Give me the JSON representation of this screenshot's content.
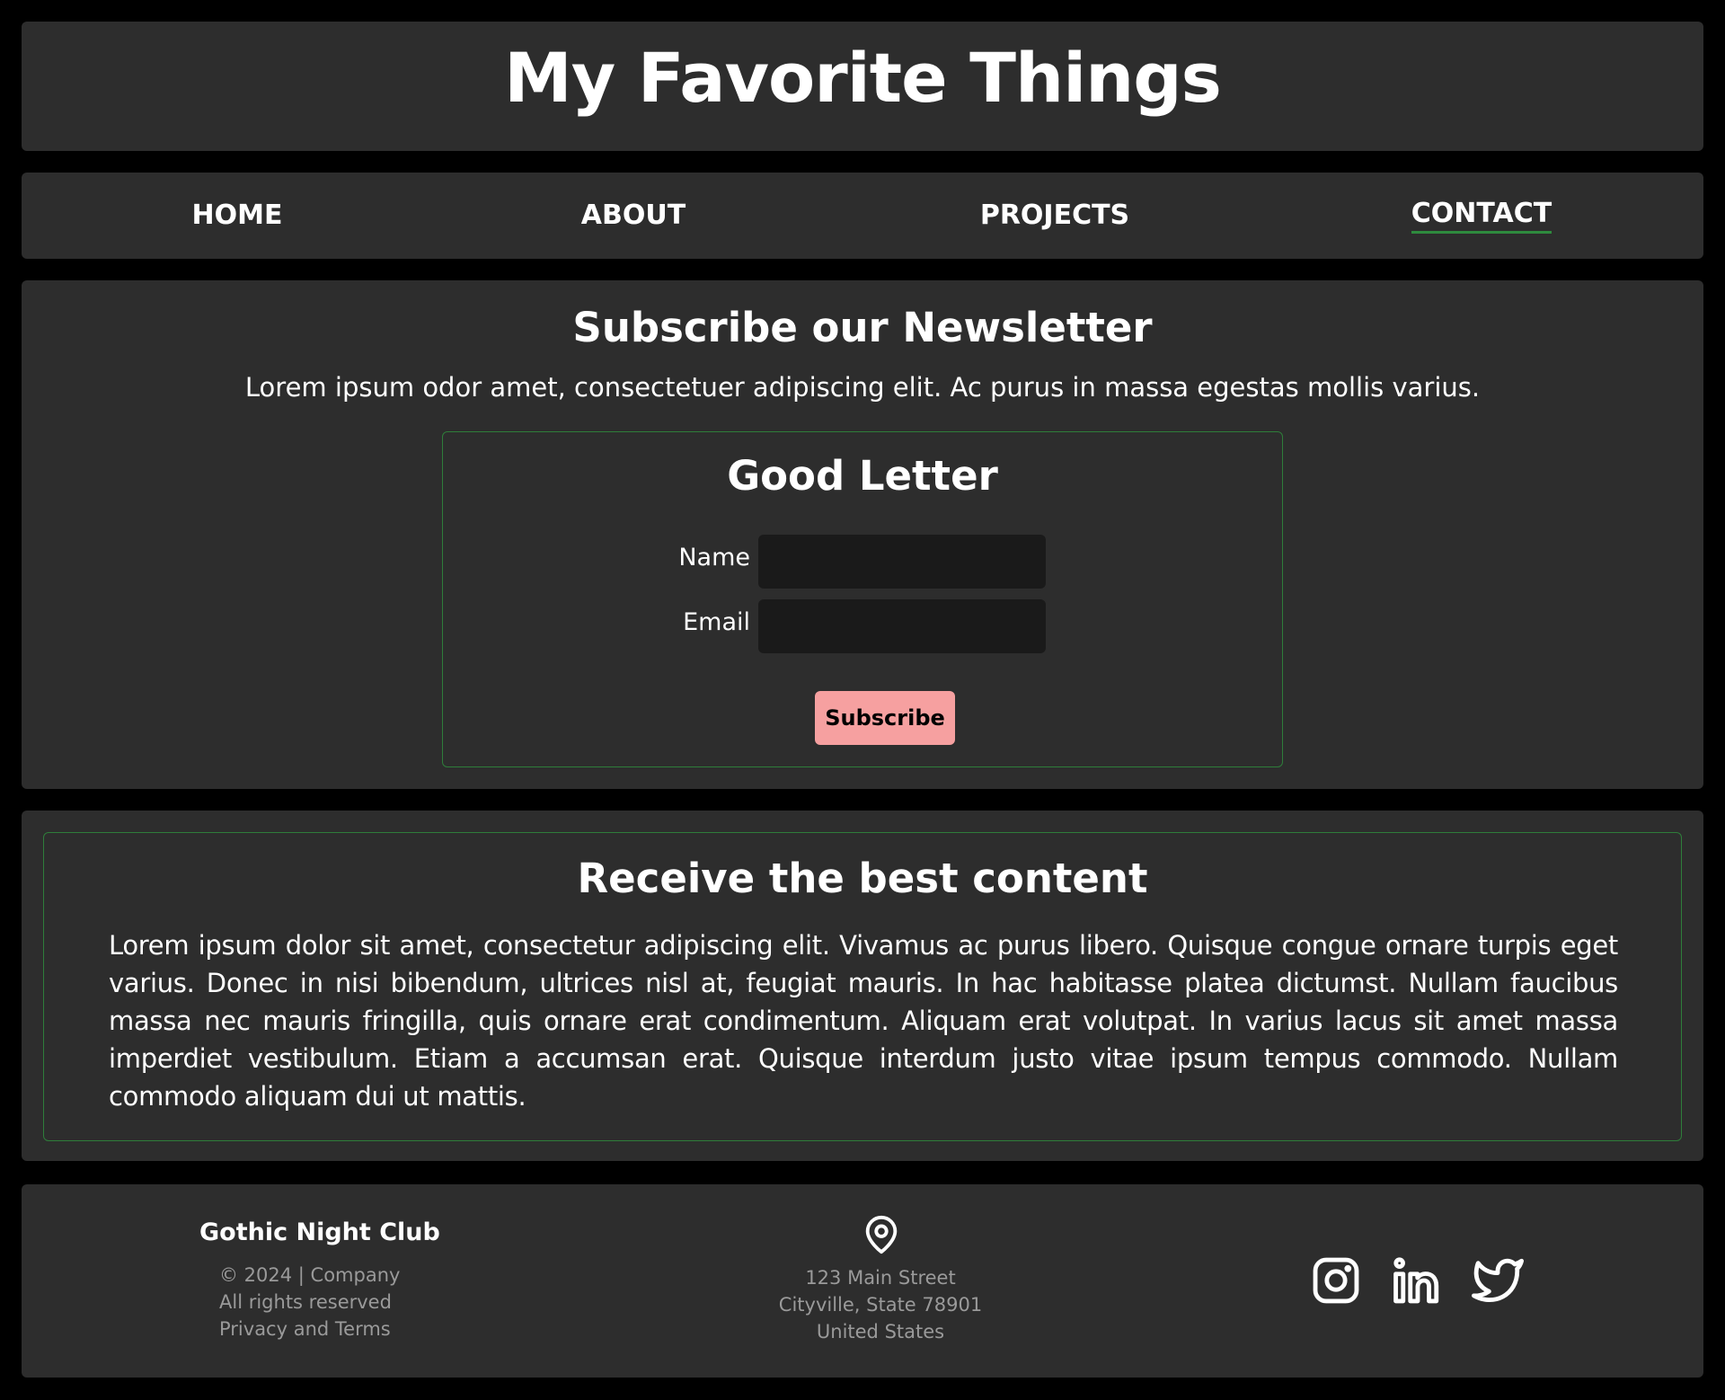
{
  "header": {
    "title": "My Favorite Things"
  },
  "nav": {
    "items": [
      {
        "label": "HOME"
      },
      {
        "label": "ABOUT"
      },
      {
        "label": "PROJECTS"
      },
      {
        "label": "CONTACT",
        "active": true
      }
    ],
    "active_underline_color": "#2e8b3e"
  },
  "newsletter": {
    "heading": "Subscribe our Newsletter",
    "lead": "Lorem ipsum odor amet, consectetuer adipiscing elit. Ac purus in massa egestas mollis varius.",
    "form": {
      "title": "Good Letter",
      "name_label": "Name",
      "name_value": "",
      "email_label": "Email",
      "email_value": "",
      "submit_label": "Subscribe"
    }
  },
  "content": {
    "heading": "Receive the best content",
    "body": "Lorem ipsum dolor sit amet, consectetur adipiscing elit. Vivamus ac purus libero. Quisque congue ornare turpis eget varius. Donec in nisi bibendum, ultrices nisl at, feugiat mauris. In hac habitasse platea dictumst. Nullam faucibus massa nec mauris fringilla, quis ornare erat condimentum. Aliquam erat volutpat. In varius lacus sit amet massa imperdiet vestibulum. Etiam a accumsan erat. Quisque interdum justo vitae ipsum tempus commodo. Nullam commodo aliquam dui ut mattis."
  },
  "footer": {
    "brand": "Gothic Night Club",
    "copyright": "© 2024 | Company",
    "rights": "All rights reserved",
    "privacy": "Privacy and Terms",
    "address": {
      "icon": "map-pin-icon",
      "street": "123 Main Street",
      "city": "Cityville, State 78901",
      "country": "United States"
    },
    "socials": [
      {
        "icon": "instagram-icon"
      },
      {
        "icon": "linkedin-icon"
      },
      {
        "icon": "twitter-icon"
      }
    ]
  },
  "colors": {
    "background": "#000000",
    "panel": "#2d2d2d",
    "input": "#1a1a1a",
    "accent_border": "#2e7d3a",
    "button": "#f6a0a0",
    "muted_text": "#9a9a9a"
  }
}
